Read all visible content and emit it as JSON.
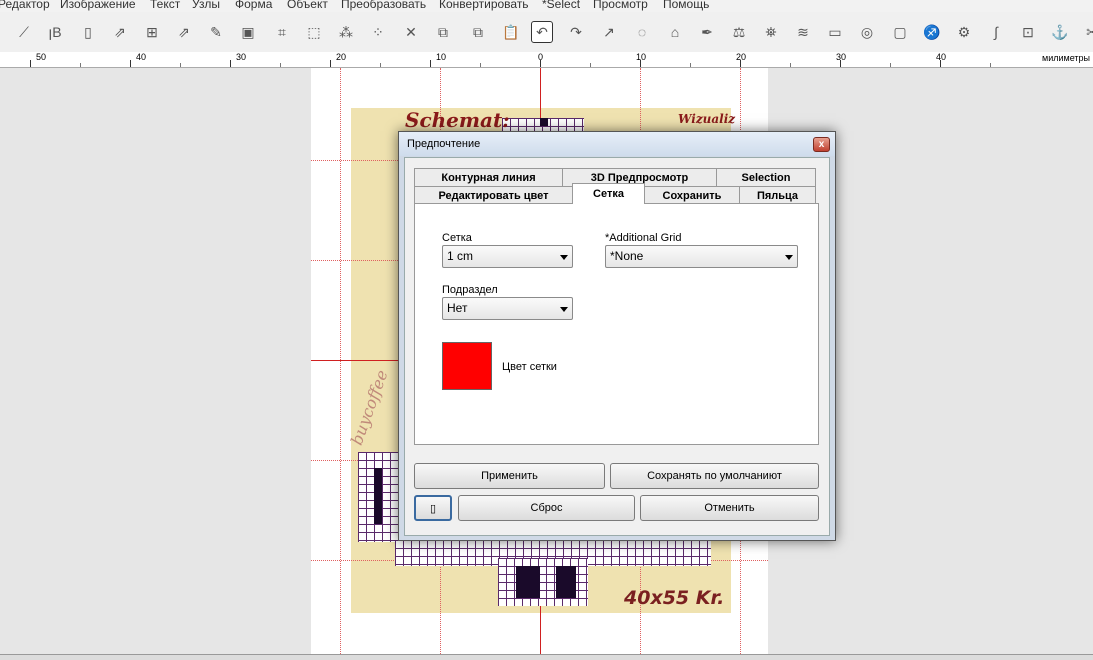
{
  "menu": [
    "Редактор",
    "Изображение",
    "Текст",
    "Узлы",
    "Форма",
    "Объект",
    "Преобразовать",
    "Конвертировать",
    "*Select",
    "Просмотр",
    "Помощь"
  ],
  "ruler": {
    "labels": [
      "50",
      "40",
      "30",
      "20",
      "10",
      "0",
      "10",
      "20",
      "30",
      "40"
    ],
    "unit": "милиметры"
  },
  "canvas": {
    "heading": "Schemat:",
    "heading_right": "Wizualiz",
    "watermark": "buycoffee",
    "size_label": "40x55 Kr."
  },
  "dialog": {
    "title": "Предпочтение",
    "close_glyph": "x",
    "tabs_row1": [
      "Контурная линия",
      "3D Предпросмотр",
      "Selection"
    ],
    "tabs_row2": [
      "Редактировать цвет",
      "Сетка",
      "Сохранить",
      "Пяльца"
    ],
    "selected_tab": "Сетка",
    "grid_label": "Сетка",
    "grid_value": "1 cm",
    "additional_label": "*Additional Grid",
    "additional_value": "*None",
    "subdiv_label": "Подраздел",
    "subdiv_value": "Нет",
    "grid_color_label": "Цвет сетки",
    "grid_color": "#ff0000",
    "apply_label": "Применить",
    "save_default_label": "Сохранять по умолчаниют",
    "reset_label": "Сброс",
    "cancel_label": "Отменить",
    "help_icon_glyph": "▯"
  }
}
